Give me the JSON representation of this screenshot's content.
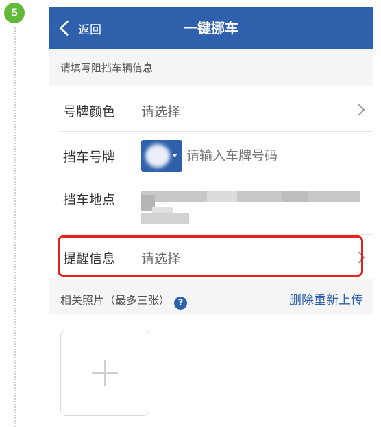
{
  "step": {
    "number": "5",
    "color": "#62b837"
  },
  "navbar": {
    "back_label": "返回",
    "title": "一键挪车",
    "color": "#2f60ac"
  },
  "form": {
    "section_hint": "请填写阻挡车辆信息",
    "plate_color": {
      "label": "号牌颜色",
      "value": "请选择"
    },
    "plate_number": {
      "label": "挡车号牌",
      "placeholder": "请输入车牌号码"
    },
    "location": {
      "label": "挡车地点"
    },
    "reminder": {
      "label": "提醒信息",
      "value": "请选择"
    }
  },
  "photos": {
    "label": "相关照片（最多三张）",
    "help_icon": "?",
    "reupload_label": "删除重新上传"
  },
  "highlight_color": "#e8201d"
}
